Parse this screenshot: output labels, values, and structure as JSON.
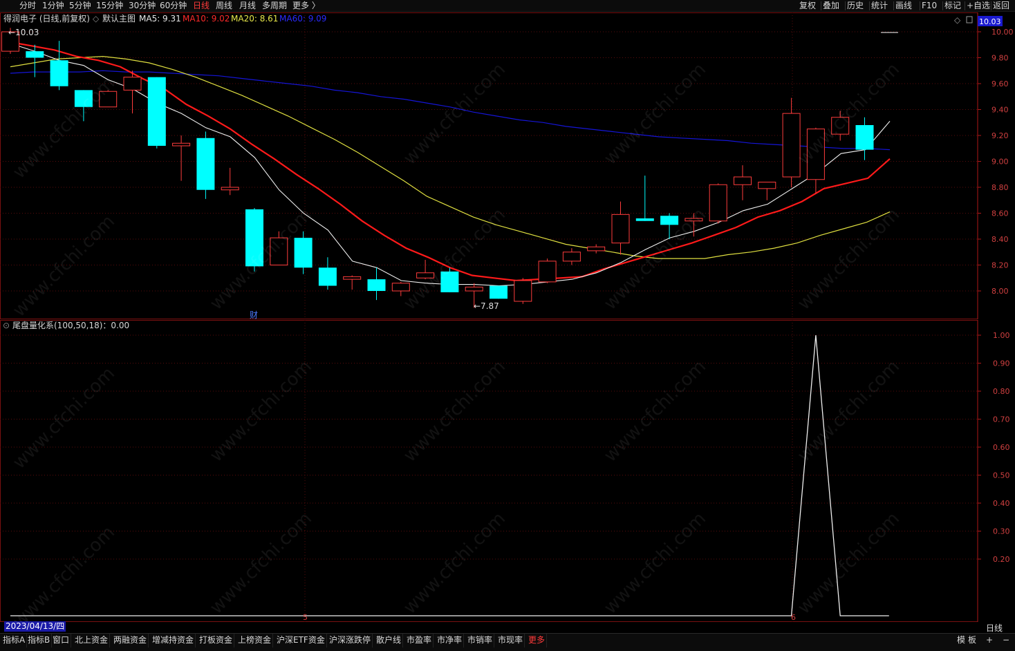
{
  "toolbar": {
    "periods": [
      "分时",
      "1分钟",
      "5分钟",
      "15分钟",
      "30分钟",
      "60分钟",
      "日线",
      "周线",
      "月线",
      "多周期",
      "更多 〉"
    ],
    "active_period": "日线",
    "right_tools": [
      "复权",
      "叠加",
      "历史",
      "统计",
      "画线",
      "F10",
      "标记",
      "+自选",
      "返回"
    ]
  },
  "main_header": {
    "stock": "得润电子 (日线,前复权)",
    "template": "默认主图",
    "ma5": "MA5: 9.31",
    "ma10": "MA10: 9.02",
    "ma20": "MA20: 8.61",
    "ma60": "MA60: 9.09"
  },
  "main_chart": {
    "high_label": "10.03",
    "low_label": "7.87",
    "price_tag": "10.03",
    "finance_marker": "财",
    "y_ticks": [
      "10.00",
      "9.80",
      "9.60",
      "9.40",
      "9.20",
      "9.00",
      "8.80",
      "8.60",
      "8.40",
      "8.20",
      "8.00"
    ]
  },
  "sub_header": {
    "indicator": "尾盘量化系(100,50,18)：0.00"
  },
  "sub_chart": {
    "y_ticks": [
      "1.00",
      "0.90",
      "0.80",
      "0.70",
      "0.60",
      "0.50",
      "0.40",
      "0.30",
      "0.20"
    ]
  },
  "x_axis": {
    "date": "2023/04/13/四",
    "month_5": "5",
    "month_6": "6",
    "period_label": "日线"
  },
  "bottom_tabs": [
    "指标A",
    "指标B",
    "窗口",
    "北上资金",
    "两融资金",
    "增减持资金",
    "打板资金",
    "上榜资金",
    "沪深ETF资金",
    "沪深涨跌停",
    "散户线",
    "市盈率",
    "市净率",
    "市销率",
    "市现率",
    "更多"
  ],
  "bottom_right": [
    "模",
    "板",
    "+",
    "−"
  ],
  "watermark": "www.cfchi.com",
  "chart_data": {
    "type": "candlestick",
    "candles": [
      {
        "o": 9.85,
        "c": 10.0,
        "h": 10.03,
        "l": 9.83
      },
      {
        "o": 9.85,
        "c": 9.8,
        "h": 9.9,
        "l": 9.65
      },
      {
        "o": 9.78,
        "c": 9.58,
        "h": 9.93,
        "l": 9.55
      },
      {
        "o": 9.55,
        "c": 9.42,
        "h": 9.55,
        "l": 9.31
      },
      {
        "o": 9.42,
        "c": 9.54,
        "h": 9.55,
        "l": 9.42
      },
      {
        "o": 9.55,
        "c": 9.65,
        "h": 9.7,
        "l": 9.37
      },
      {
        "o": 9.65,
        "c": 9.12,
        "h": 9.65,
        "l": 9.1
      },
      {
        "o": 9.12,
        "c": 9.14,
        "h": 9.2,
        "l": 8.85
      },
      {
        "o": 9.18,
        "c": 8.78,
        "h": 9.23,
        "l": 8.71
      },
      {
        "o": 8.78,
        "c": 8.8,
        "h": 8.95,
        "l": 8.74
      },
      {
        "o": 8.63,
        "c": 8.19,
        "h": 8.64,
        "l": 8.15
      },
      {
        "o": 8.2,
        "c": 8.41,
        "h": 8.46,
        "l": 8.2
      },
      {
        "o": 8.41,
        "c": 8.18,
        "h": 8.46,
        "l": 8.13
      },
      {
        "o": 8.18,
        "c": 8.04,
        "h": 8.26,
        "l": 8.01
      },
      {
        "o": 8.09,
        "c": 8.11,
        "h": 8.12,
        "l": 8.01
      },
      {
        "o": 8.09,
        "c": 8.0,
        "h": 8.18,
        "l": 7.93
      },
      {
        "o": 8.0,
        "c": 8.06,
        "h": 8.07,
        "l": 7.96
      },
      {
        "o": 8.1,
        "c": 8.14,
        "h": 8.24,
        "l": 8.09
      },
      {
        "o": 8.15,
        "c": 7.99,
        "h": 8.18,
        "l": 7.99
      },
      {
        "o": 8.0,
        "c": 8.03,
        "h": 8.06,
        "l": 7.87
      },
      {
        "o": 8.04,
        "c": 7.94,
        "h": 8.04,
        "l": 7.94
      },
      {
        "o": 7.92,
        "c": 8.08,
        "h": 8.1,
        "l": 7.9
      },
      {
        "o": 8.07,
        "c": 8.23,
        "h": 8.25,
        "l": 8.06
      },
      {
        "o": 8.23,
        "c": 8.3,
        "h": 8.33,
        "l": 8.2
      },
      {
        "o": 8.31,
        "c": 8.34,
        "h": 8.36,
        "l": 8.29
      },
      {
        "o": 8.37,
        "c": 8.59,
        "h": 8.69,
        "l": 8.28
      },
      {
        "o": 8.56,
        "c": 8.54,
        "h": 8.89,
        "l": 8.54
      },
      {
        "o": 8.58,
        "c": 8.51,
        "h": 8.6,
        "l": 8.4
      },
      {
        "o": 8.54,
        "c": 8.56,
        "h": 8.6,
        "l": 8.42
      },
      {
        "o": 8.54,
        "c": 8.82,
        "h": 8.83,
        "l": 8.52
      },
      {
        "o": 8.82,
        "c": 8.88,
        "h": 8.97,
        "l": 8.7
      },
      {
        "o": 8.79,
        "c": 8.84,
        "h": 8.84,
        "l": 8.7
      },
      {
        "o": 8.88,
        "c": 9.37,
        "h": 9.49,
        "l": 8.8
      },
      {
        "o": 8.86,
        "c": 9.25,
        "h": 9.26,
        "l": 8.75
      },
      {
        "o": 9.21,
        "c": 9.34,
        "h": 9.39,
        "l": 9.16
      },
      {
        "o": 9.28,
        "c": 9.09,
        "h": 9.34,
        "l": 9.01
      }
    ],
    "ma5": [
      9.91,
      9.85,
      9.78,
      9.74,
      9.63,
      9.56,
      9.45,
      9.37,
      9.26,
      9.19,
      9.03,
      8.78,
      8.6,
      8.47,
      8.23,
      8.18,
      8.08,
      8.06,
      8.05,
      8.05,
      8.04,
      8.05,
      8.07,
      8.09,
      8.14,
      8.22,
      8.32,
      8.41,
      8.46,
      8.53,
      8.62,
      8.67,
      8.79,
      8.91,
      9.06,
      9.09,
      9.31
    ],
    "ma10": [
      9.92,
      9.89,
      9.86,
      9.81,
      9.78,
      9.73,
      9.64,
      9.56,
      9.44,
      9.35,
      9.25,
      9.13,
      9.02,
      8.9,
      8.79,
      8.67,
      8.54,
      8.43,
      8.33,
      8.26,
      8.18,
      8.12,
      8.1,
      8.08,
      8.09,
      8.1,
      8.11,
      8.17,
      8.22,
      8.27,
      8.32,
      8.37,
      8.43,
      8.49,
      8.57,
      8.62,
      8.69,
      8.79,
      8.83,
      8.87,
      9.02
    ],
    "ma20": [
      9.73,
      9.76,
      9.79,
      9.8,
      9.81,
      9.79,
      9.76,
      9.71,
      9.65,
      9.58,
      9.51,
      9.43,
      9.35,
      9.26,
      9.17,
      9.07,
      8.96,
      8.85,
      8.73,
      8.65,
      8.57,
      8.51,
      8.46,
      8.41,
      8.36,
      8.33,
      8.3,
      8.27,
      8.25,
      8.25,
      8.25,
      8.28,
      8.3,
      8.33,
      8.37,
      8.43,
      8.48,
      8.53,
      8.61
    ],
    "ma60": [
      9.68,
      9.69,
      9.69,
      9.69,
      9.7,
      9.69,
      9.69,
      9.68,
      9.67,
      9.66,
      9.64,
      9.62,
      9.6,
      9.58,
      9.55,
      9.53,
      9.5,
      9.48,
      9.45,
      9.42,
      9.38,
      9.35,
      9.32,
      9.3,
      9.27,
      9.25,
      9.23,
      9.21,
      9.19,
      9.18,
      9.17,
      9.16,
      9.14,
      9.13,
      9.12,
      9.11,
      9.1,
      9.1,
      9.09
    ],
    "indicator": {
      "name": "尾盘量化系",
      "values": [
        0,
        0,
        0,
        0,
        0,
        0,
        0,
        0,
        0,
        0,
        0,
        0,
        0,
        0,
        0,
        0,
        0,
        0,
        0,
        0,
        0,
        0,
        0,
        0,
        0,
        0,
        0,
        0,
        0,
        0,
        0,
        0,
        0,
        1,
        0,
        0,
        0
      ]
    },
    "ylim_main": [
      7.8,
      10.1
    ],
    "ylim_sub": [
      0,
      1.0
    ]
  }
}
